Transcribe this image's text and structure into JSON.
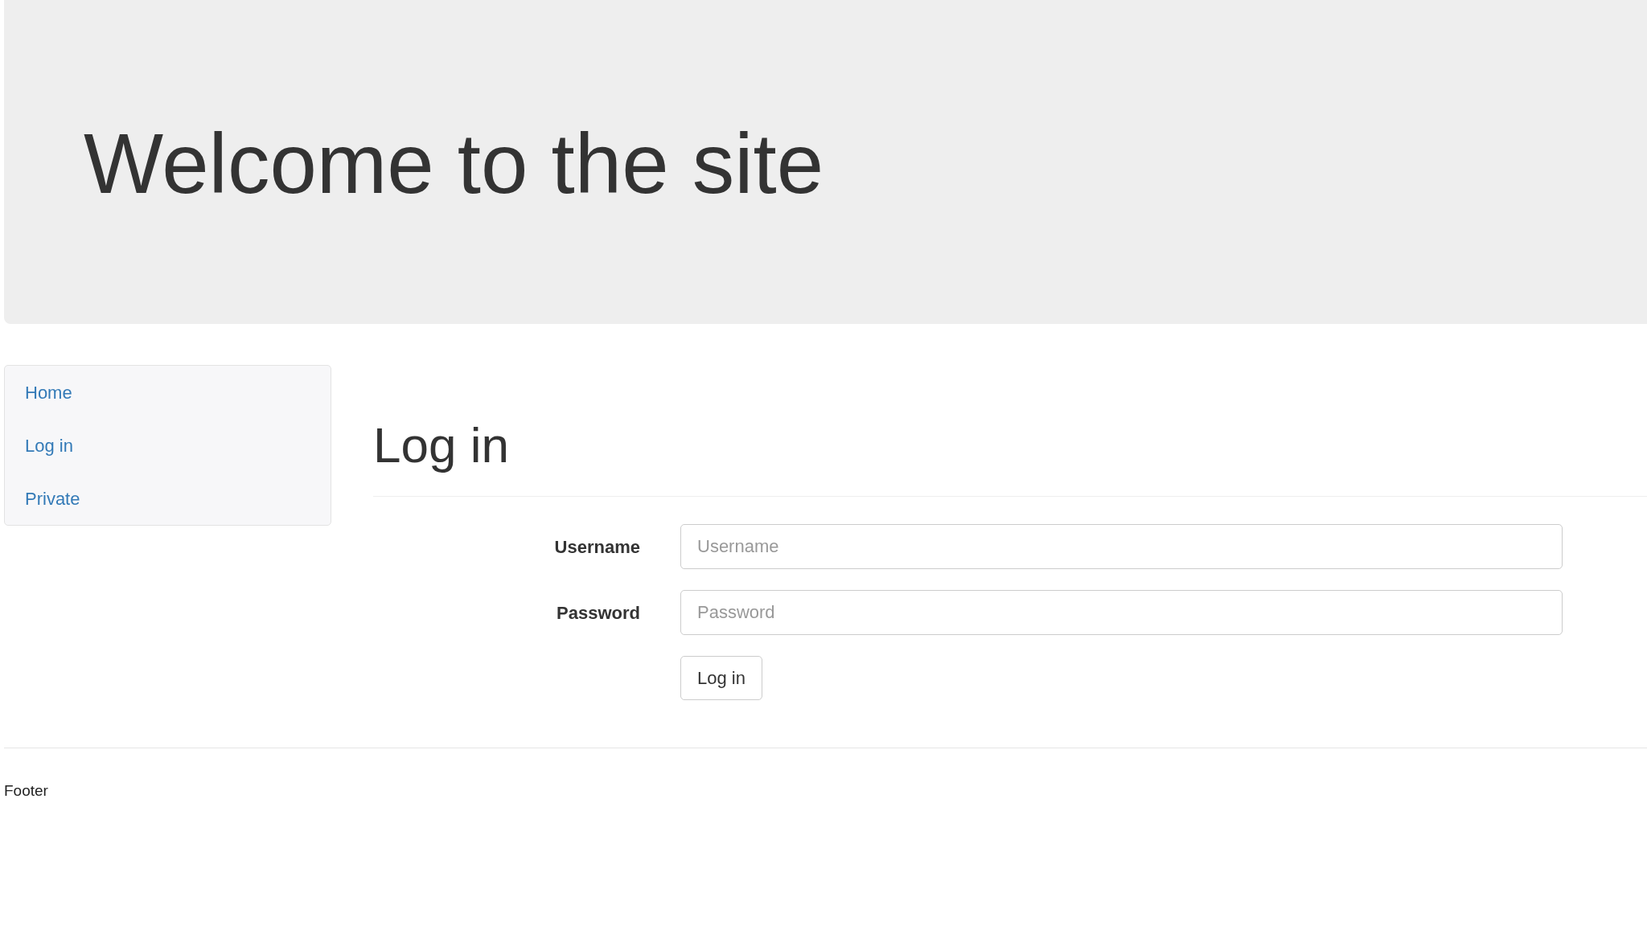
{
  "jumbotron": {
    "heading": "Welcome to the site"
  },
  "sidebar": {
    "items": [
      {
        "label": "Home"
      },
      {
        "label": "Log in"
      },
      {
        "label": "Private"
      }
    ]
  },
  "main": {
    "heading": "Log in",
    "fields": [
      {
        "label": "Username",
        "placeholder": "Username"
      },
      {
        "label": "Password",
        "placeholder": "Password"
      }
    ],
    "submit": "Log in"
  },
  "footer": {
    "text": "Footer"
  }
}
